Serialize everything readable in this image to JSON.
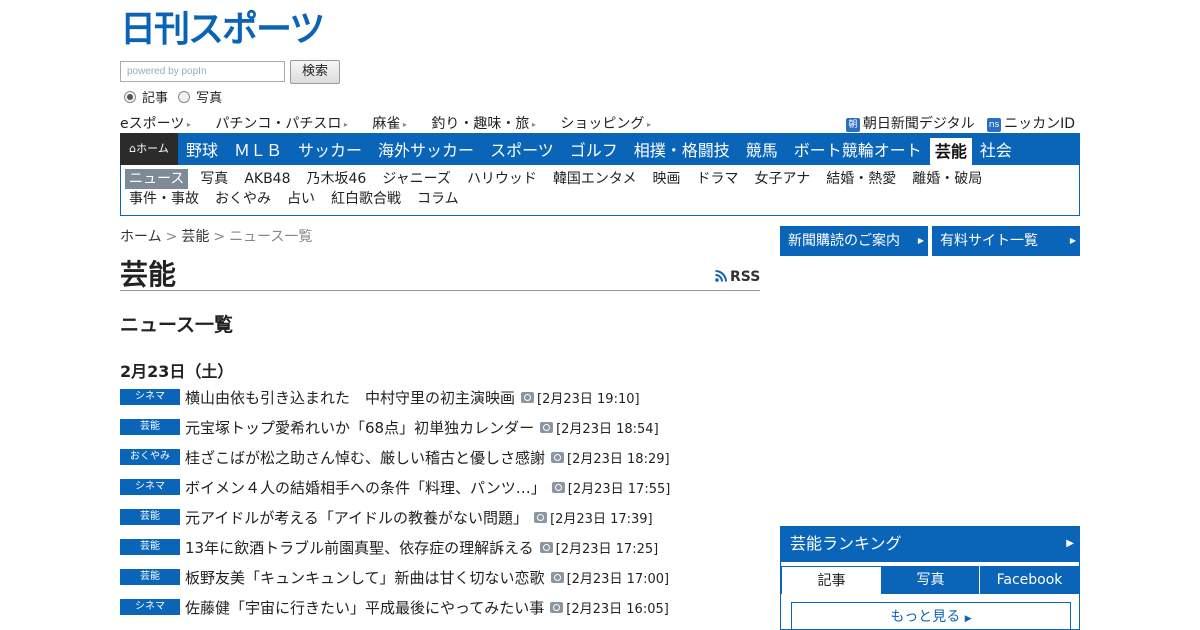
{
  "logo_text": "日刊スポーツ",
  "search": {
    "placeholder": "powered by popIn",
    "button": "検索",
    "radio_article": "記事",
    "radio_photo": "写真"
  },
  "toplinks": [
    "eスポーツ",
    "パチンコ・パチスロ",
    "麻雀",
    "釣り・趣味・旅",
    "ショッピング"
  ],
  "toplinks_right": {
    "asahi_icon": "朝",
    "asahi": "朝日新聞デジタル",
    "ns_icon": "ns",
    "nikkan_id": "ニッカンID"
  },
  "mainnav": {
    "home": "ホーム",
    "items": [
      "野球",
      "ＭＬＢ",
      "サッカー",
      "海外サッカー",
      "スポーツ",
      "ゴルフ",
      "相撲・格闘技",
      "競馬",
      "ボート競輪オート",
      "芸能",
      "社会"
    ],
    "active_index": 9
  },
  "subnav": {
    "items": [
      "ニュース",
      "写真",
      "AKB48",
      "乃木坂46",
      "ジャニーズ",
      "ハリウッド",
      "韓国エンタメ",
      "映画",
      "ドラマ",
      "女子アナ",
      "結婚・熱愛",
      "離婚・破局",
      "事件・事故",
      "おくやみ",
      "占い",
      "紅白歌合戦",
      "コラム"
    ],
    "active_index": 0
  },
  "breadcrumb": {
    "home": "ホーム",
    "sep": ">",
    "section": "芸能",
    "current": "ニュース一覧"
  },
  "page_title": "芸能",
  "rss_label": "RSS",
  "section_title": "ニュース一覧",
  "date_heading": "2月23日（土）",
  "news": [
    {
      "tag": "シネマ",
      "title": "横山由依も引き込まれた　中村守里の初主演映画",
      "time": "[2月23日 19:10]"
    },
    {
      "tag": "芸能",
      "title": "元宝塚トップ愛希れいか「68点」初単独カレンダー",
      "time": "[2月23日 18:54]"
    },
    {
      "tag": "おくやみ",
      "title": "桂ざこばが松之助さん悼む、厳しい稽古と優しさ感謝",
      "time": "[2月23日 18:29]"
    },
    {
      "tag": "シネマ",
      "title": "ボイメン４人の結婚相手への条件「料理、パンツ…」",
      "time": "[2月23日 17:55]"
    },
    {
      "tag": "芸能",
      "title": "元アイドルが考える「アイドルの教養がない問題」",
      "time": "[2月23日 17:39]"
    },
    {
      "tag": "芸能",
      "title": "13年に飲酒トラブル前園真聖、依存症の理解訴える",
      "time": "[2月23日 17:25]"
    },
    {
      "tag": "芸能",
      "title": "板野友美「キュンキュンして」新曲は甘く切ない恋歌",
      "time": "[2月23日 17:00]"
    },
    {
      "tag": "シネマ",
      "title": "佐藤健「宇宙に行きたい」平成最後にやってみたい事",
      "time": "[2月23日 16:05]"
    }
  ],
  "right": {
    "subscription": "新聞購読のご案内",
    "paid_sites": "有料サイト一覧",
    "ranking_title": "芸能ランキング",
    "tabs": [
      "記事",
      "写真",
      "Facebook"
    ],
    "more": "もっと見る"
  },
  "colors": {
    "brand_blue": "#0a64b8",
    "home_bg": "#2b2b2b",
    "sub_active": "#7e8a96"
  }
}
